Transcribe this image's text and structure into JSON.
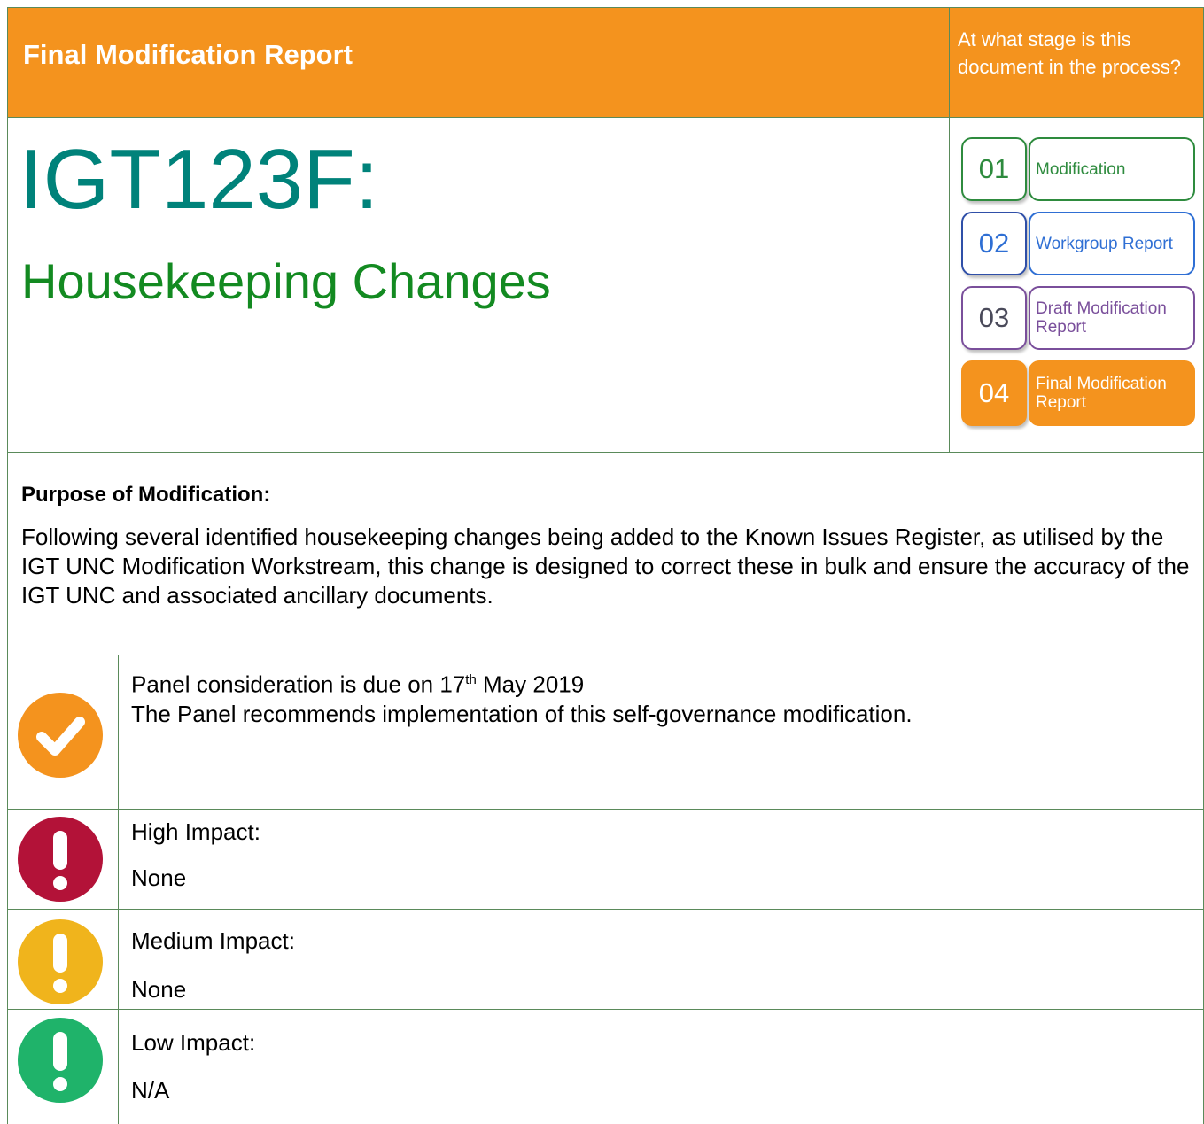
{
  "header": {
    "report_type": "Final Modification Report",
    "stage_question": "At what stage is this document in the process?"
  },
  "modification": {
    "code": "IGT123F:",
    "title": "Housekeeping Changes"
  },
  "stages": [
    {
      "number": "01",
      "label": "Modification",
      "color": "#2e8b3e"
    },
    {
      "number": "02",
      "label": "Workgroup Report",
      "color": "#2f6fd4"
    },
    {
      "number": "03",
      "label": "Draft Modification Report",
      "color": "#7a4f9b"
    },
    {
      "number": "04",
      "label": "Final Modification Report",
      "color": "#f4931e"
    }
  ],
  "purpose": {
    "heading": "Purpose of Modification:",
    "text": "Following several identified housekeeping changes being added to the Known Issues Register, as utilised by the IGT UNC Modification Workstream, this change is designed to correct these in bulk and ensure the accuracy of the IGT UNC and associated ancillary documents."
  },
  "panel": {
    "line1_prefix": "Panel consideration is due on 17",
    "line1_sup": "th",
    "line1_suffix": " May 2019",
    "line2": "The Panel recommends implementation of this self-governance modification."
  },
  "impacts": [
    {
      "label": "High Impact:",
      "value": "None",
      "color": "#b31238"
    },
    {
      "label": "Medium Impact:",
      "value": "None",
      "color": "#f0b41c"
    },
    {
      "label": "Low Impact:",
      "value": "N/A",
      "color": "#1fb36a"
    }
  ],
  "colors": {
    "header_orange": "#f4931e",
    "border_green": "#5a8a5a"
  }
}
